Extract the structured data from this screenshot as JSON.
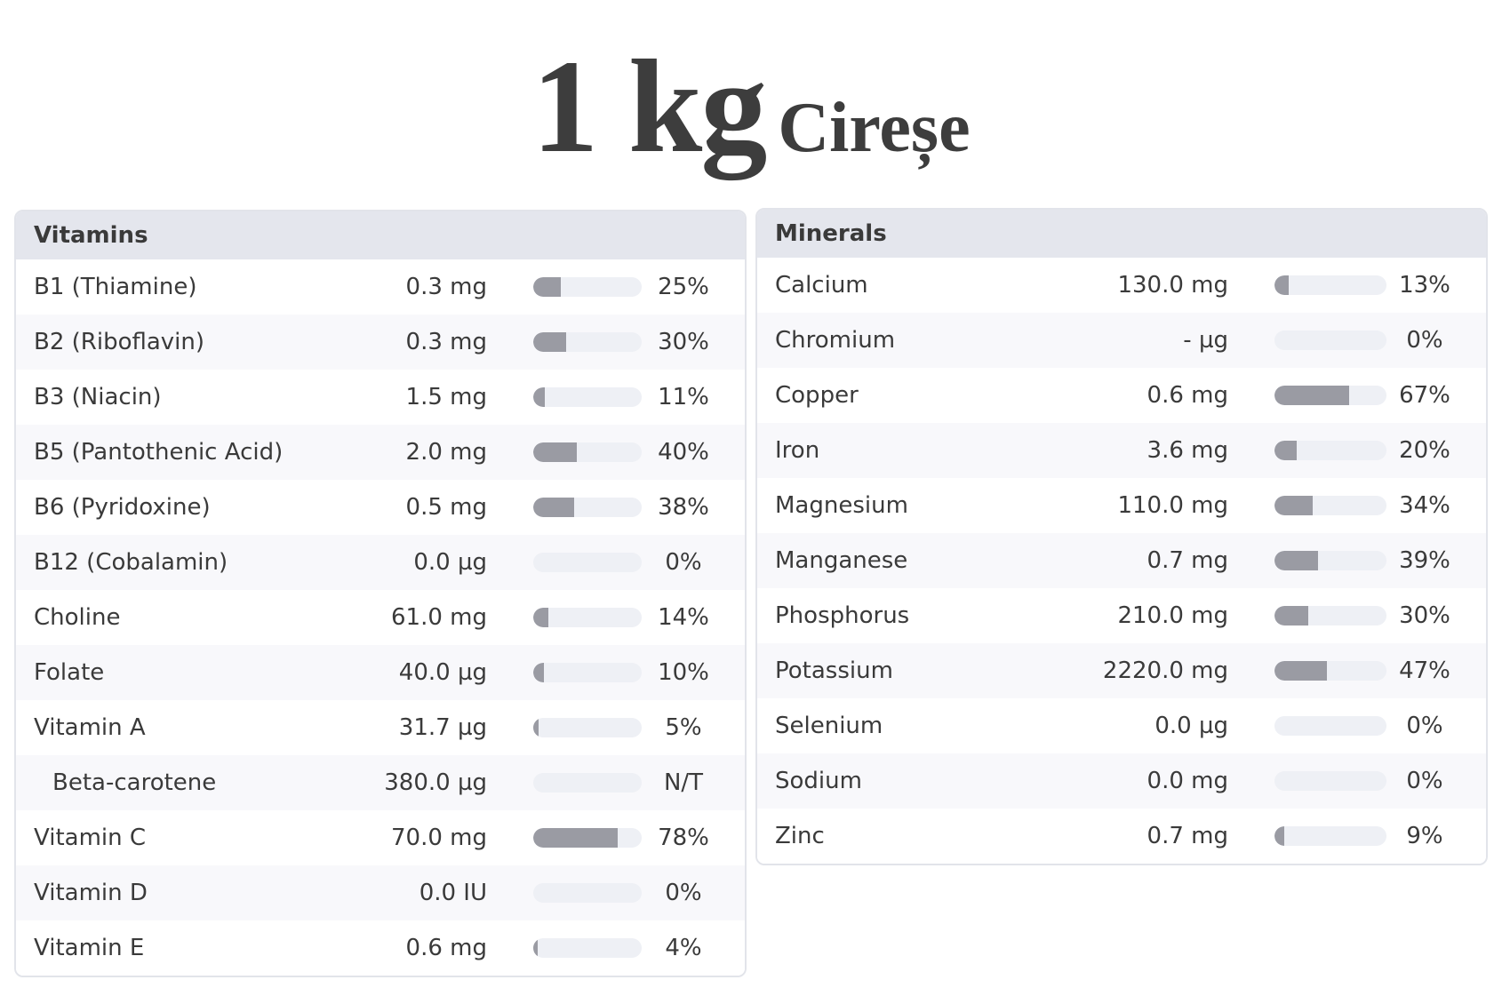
{
  "title": {
    "quantity": "1 kg",
    "food": "Cireșe"
  },
  "vitamins": {
    "header": "Vitamins",
    "rows": [
      {
        "name": "B1 (Thiamine)",
        "amount": "0.3 mg",
        "percent_label": "25%",
        "percent": 25
      },
      {
        "name": "B2 (Riboflavin)",
        "amount": "0.3 mg",
        "percent_label": "30%",
        "percent": 30
      },
      {
        "name": "B3 (Niacin)",
        "amount": "1.5 mg",
        "percent_label": "11%",
        "percent": 11
      },
      {
        "name": "B5 (Pantothenic Acid)",
        "amount": "2.0 mg",
        "percent_label": "40%",
        "percent": 40
      },
      {
        "name": "B6 (Pyridoxine)",
        "amount": "0.5 mg",
        "percent_label": "38%",
        "percent": 38
      },
      {
        "name": "B12 (Cobalamin)",
        "amount": "0.0 µg",
        "percent_label": "0%",
        "percent": 0
      },
      {
        "name": "Choline",
        "amount": "61.0 mg",
        "percent_label": "14%",
        "percent": 14
      },
      {
        "name": "Folate",
        "amount": "40.0 µg",
        "percent_label": "10%",
        "percent": 10
      },
      {
        "name": "Vitamin A",
        "amount": "31.7 µg",
        "percent_label": "5%",
        "percent": 5
      },
      {
        "name": "Beta-carotene",
        "amount": "380.0 µg",
        "percent_label": "N/T",
        "percent": 0,
        "sub": true
      },
      {
        "name": "Vitamin C",
        "amount": "70.0 mg",
        "percent_label": "78%",
        "percent": 78
      },
      {
        "name": "Vitamin D",
        "amount": "0.0 IU",
        "percent_label": "0%",
        "percent": 0
      },
      {
        "name": "Vitamin E",
        "amount": "0.6 mg",
        "percent_label": "4%",
        "percent": 4
      }
    ]
  },
  "minerals": {
    "header": "Minerals",
    "rows": [
      {
        "name": "Calcium",
        "amount": "130.0 mg",
        "percent_label": "13%",
        "percent": 13
      },
      {
        "name": "Chromium",
        "amount": "- µg",
        "percent_label": "0%",
        "percent": 0
      },
      {
        "name": "Copper",
        "amount": "0.6 mg",
        "percent_label": "67%",
        "percent": 67
      },
      {
        "name": "Iron",
        "amount": "3.6 mg",
        "percent_label": "20%",
        "percent": 20
      },
      {
        "name": "Magnesium",
        "amount": "110.0 mg",
        "percent_label": "34%",
        "percent": 34
      },
      {
        "name": "Manganese",
        "amount": "0.7 mg",
        "percent_label": "39%",
        "percent": 39
      },
      {
        "name": "Phosphorus",
        "amount": "210.0 mg",
        "percent_label": "30%",
        "percent": 30
      },
      {
        "name": "Potassium",
        "amount": "2220.0 mg",
        "percent_label": "47%",
        "percent": 47
      },
      {
        "name": "Selenium",
        "amount": "0.0 µg",
        "percent_label": "0%",
        "percent": 0
      },
      {
        "name": "Sodium",
        "amount": "0.0 mg",
        "percent_label": "0%",
        "percent": 0
      },
      {
        "name": "Zinc",
        "amount": "0.7 mg",
        "percent_label": "9%",
        "percent": 9
      }
    ]
  },
  "colors": {
    "bar_fill": "#9a9ba3",
    "bar_track": "#eef0f5",
    "header_bg": "#e4e6ed",
    "text": "#3a3a3a"
  }
}
